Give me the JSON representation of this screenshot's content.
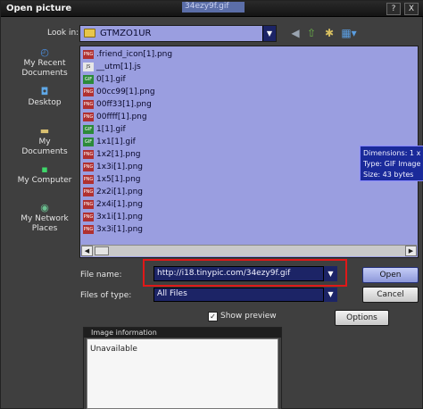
{
  "window": {
    "title": "Open picture",
    "title_ghost": "34ezy9f.gif",
    "help_glyph": "?",
    "close_glyph": "X"
  },
  "lookin": {
    "label": "Look in:",
    "value": "GTMZO1UR",
    "toolbar_icons": [
      "back-arrow-icon",
      "up-folder-icon",
      "new-folder-icon",
      "views-menu-icon"
    ]
  },
  "places": [
    {
      "label": "My Recent Documents",
      "icon": "recent-documents-icon"
    },
    {
      "label": "Desktop",
      "icon": "desktop-icon"
    },
    {
      "label": "My Documents",
      "icon": "my-documents-icon"
    },
    {
      "label": "My Computer",
      "icon": "my-computer-icon"
    },
    {
      "label": "My Network Places",
      "icon": "network-places-icon"
    }
  ],
  "files": [
    {
      "name": ".friend_icon[1].png",
      "type": "png"
    },
    {
      "name": "__utm[1].js",
      "type": "js"
    },
    {
      "name": "0[1].gif",
      "type": "gif"
    },
    {
      "name": "00cc99[1].png",
      "type": "png"
    },
    {
      "name": "00ff33[1].png",
      "type": "png"
    },
    {
      "name": "00ffff[1].png",
      "type": "png"
    },
    {
      "name": "1[1].gif",
      "type": "gif"
    },
    {
      "name": "1x1[1].gif",
      "type": "gif"
    },
    {
      "name": "1x2[1].png",
      "type": "png"
    },
    {
      "name": "1x3i[1].png",
      "type": "png"
    },
    {
      "name": "1x5[1].png",
      "type": "png"
    },
    {
      "name": "2x2i[1].png",
      "type": "png"
    },
    {
      "name": "2x4i[1].png",
      "type": "png"
    },
    {
      "name": "3x1i[1].png",
      "type": "png"
    },
    {
      "name": "3x3i[1].png",
      "type": "png"
    }
  ],
  "badges": {
    "png": "PNG",
    "gif": "GIF",
    "js": "JS"
  },
  "tooltip": {
    "lines": [
      "Dimensions: 1 x",
      "Type: GIF Image",
      "Size: 43 bytes"
    ]
  },
  "filename": {
    "label": "File name:",
    "value": "http://i18.tinypic.com/34ezy9f.gif"
  },
  "filetype": {
    "label": "Files of type:",
    "value": "All Files"
  },
  "buttons": {
    "open": "Open",
    "cancel": "Cancel",
    "options": "Options"
  },
  "show_preview": {
    "label": "Show preview",
    "checked": true
  },
  "image_info": {
    "header": "Image information",
    "text": "Unavailable"
  },
  "colors": {
    "list_background": "#9a9ee0",
    "selection_navy": "#1c2466",
    "highlight_red": "#e01818",
    "tooltip_blue": "#1a2a9a"
  }
}
